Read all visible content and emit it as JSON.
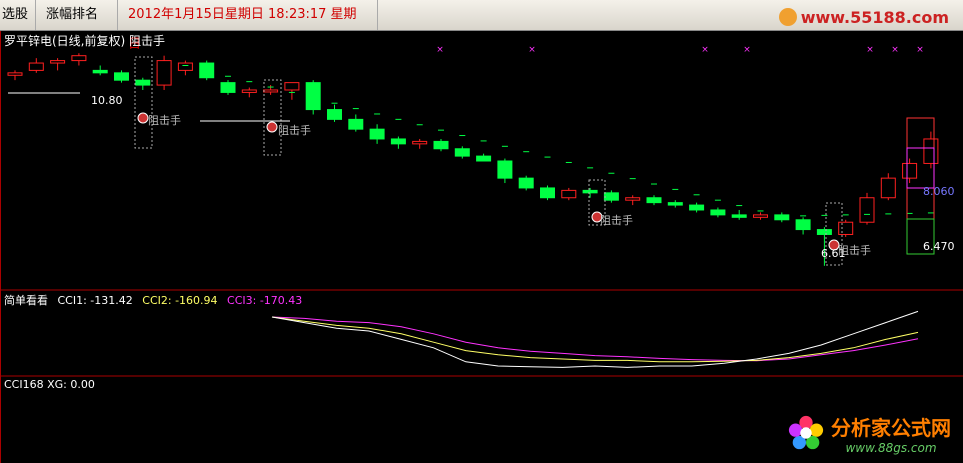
{
  "tabs": [
    {
      "label": "选股"
    },
    {
      "label": "涨幅排名"
    },
    {
      "label": "2012年1月15日星期日  18:23:17 星期日"
    }
  ],
  "watermark_top": "www.55188.com",
  "main_pane": {
    "title": "罗平锌电(日线,前复权) 阻击手",
    "high_label": "10.80",
    "low_label": "6.61",
    "right_label_1": "8.060",
    "right_label_2": "6.470",
    "signal_text": "阻击手"
  },
  "cci_pane": {
    "name": "简单看看",
    "cci1": "CCI1: -131.42",
    "cci2": "CCI2: -160.94",
    "cci3": "CCI3: -170.43",
    "colors": {
      "cci1": "#ffffff",
      "cci2": "#ffff66",
      "cci3": "#ff33ff"
    }
  },
  "bottom_pane": {
    "label": "CCI168  XG: 0.00"
  },
  "watermark_bottom": {
    "title": "分析家公式网",
    "url": "www.88gs.com"
  },
  "chart_data": {
    "type": "candlestick",
    "ohlc": [
      [
        10.5,
        10.6,
        10.4,
        10.55
      ],
      [
        10.6,
        10.85,
        10.55,
        10.75
      ],
      [
        10.75,
        10.85,
        10.6,
        10.8
      ],
      [
        10.8,
        10.95,
        10.7,
        10.9
      ],
      [
        10.6,
        10.7,
        10.5,
        10.55
      ],
      [
        10.55,
        10.6,
        10.35,
        10.4
      ],
      [
        10.4,
        10.45,
        10.2,
        10.3
      ],
      [
        10.3,
        10.9,
        10.2,
        10.8
      ],
      [
        10.6,
        10.8,
        10.5,
        10.75
      ],
      [
        10.75,
        10.8,
        10.4,
        10.45
      ],
      [
        10.35,
        10.4,
        10.1,
        10.15
      ],
      [
        10.15,
        10.25,
        10.05,
        10.2
      ],
      [
        10.2,
        10.3,
        10.1,
        10.2
      ],
      [
        10.2,
        10.35,
        10.0,
        10.35
      ],
      [
        10.35,
        10.4,
        9.7,
        9.8
      ],
      [
        9.8,
        9.9,
        9.55,
        9.6
      ],
      [
        9.6,
        9.7,
        9.35,
        9.4
      ],
      [
        9.4,
        9.5,
        9.1,
        9.2
      ],
      [
        9.2,
        9.25,
        9.0,
        9.1
      ],
      [
        9.1,
        9.2,
        9.0,
        9.15
      ],
      [
        9.15,
        9.2,
        8.95,
        9.0
      ],
      [
        9.0,
        9.05,
        8.8,
        8.85
      ],
      [
        8.85,
        8.9,
        8.75,
        8.75
      ],
      [
        8.75,
        8.8,
        8.3,
        8.4
      ],
      [
        8.4,
        8.45,
        8.15,
        8.2
      ],
      [
        8.2,
        8.25,
        7.95,
        8.0
      ],
      [
        8.0,
        8.2,
        7.95,
        8.15
      ],
      [
        8.15,
        8.2,
        8.0,
        8.1
      ],
      [
        8.1,
        8.15,
        7.9,
        7.95
      ],
      [
        7.95,
        8.05,
        7.85,
        8.0
      ],
      [
        8.0,
        8.05,
        7.85,
        7.9
      ],
      [
        7.9,
        7.95,
        7.8,
        7.85
      ],
      [
        7.85,
        7.9,
        7.7,
        7.75
      ],
      [
        7.75,
        7.8,
        7.6,
        7.65
      ],
      [
        7.65,
        7.75,
        7.55,
        7.6
      ],
      [
        7.6,
        7.7,
        7.55,
        7.65
      ],
      [
        7.65,
        7.7,
        7.5,
        7.55
      ],
      [
        7.55,
        7.6,
        7.25,
        7.35
      ],
      [
        7.35,
        7.4,
        6.61,
        7.25
      ],
      [
        7.25,
        7.55,
        7.2,
        7.5
      ],
      [
        7.5,
        8.1,
        7.45,
        8.0
      ],
      [
        8.0,
        8.5,
        7.95,
        8.4
      ],
      [
        8.4,
        8.8,
        8.3,
        8.7
      ],
      [
        8.7,
        9.35,
        8.6,
        9.2
      ]
    ],
    "cci1": [
      -40,
      -60,
      -80,
      -90,
      -120,
      -150,
      -200,
      -215,
      -218,
      -220,
      -215,
      -220,
      -215,
      -215,
      -205,
      -190,
      -170,
      -140,
      -100,
      -60,
      -20
    ],
    "cci2": [
      -40,
      -55,
      -70,
      -80,
      -100,
      -130,
      -160,
      -175,
      -185,
      -190,
      -195,
      -195,
      -200,
      -200,
      -198,
      -195,
      -185,
      -170,
      -150,
      -120,
      -95
    ],
    "cci3": [
      -40,
      -45,
      -55,
      -60,
      -75,
      -100,
      -130,
      -150,
      -162,
      -170,
      -178,
      -182,
      -188,
      -192,
      -195,
      -196,
      -190,
      -175,
      -160,
      -140,
      -118
    ]
  }
}
